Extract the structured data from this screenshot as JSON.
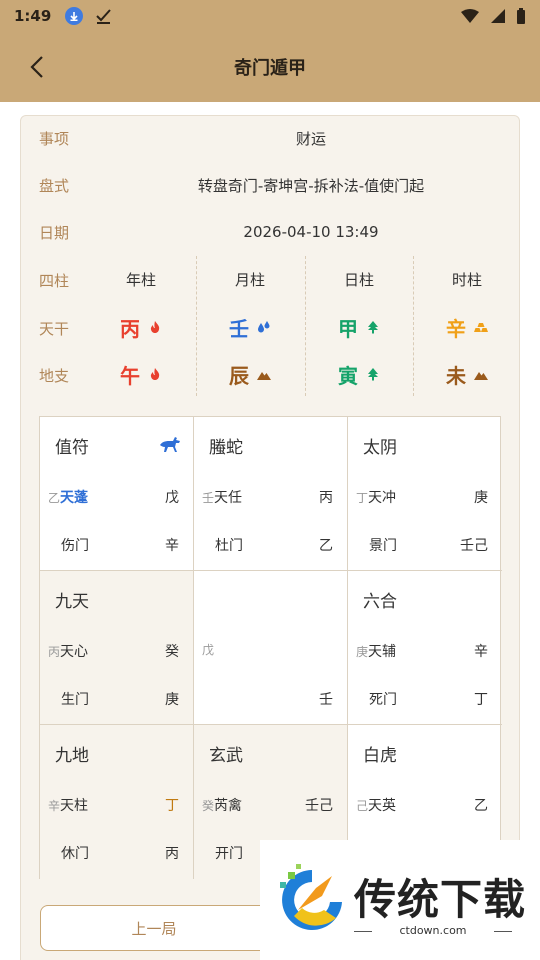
{
  "status": {
    "time": "1:49"
  },
  "header": {
    "title": "奇门遁甲"
  },
  "info": {
    "shixiang_label": "事项",
    "shixiang_value": "财运",
    "panshi_label": "盘式",
    "panshi_value": "转盘奇门-寄坤宫-拆补法-值使门起",
    "riqi_label": "日期",
    "riqi_value": "2026-04-10 13:49"
  },
  "pillars": {
    "label": "四柱",
    "tiangan_label": "天干",
    "dizhi_label": "地支",
    "headers": [
      "年柱",
      "月柱",
      "日柱",
      "时柱"
    ],
    "tiangan": [
      "丙",
      "壬",
      "甲",
      "辛"
    ],
    "dizhi": [
      "午",
      "辰",
      "寅",
      "未"
    ],
    "colors": {
      "fire": "#e8402e",
      "water": "#2f6fd6",
      "wood": "#16a36a",
      "metal": "#f0a018",
      "earth": "#9a5a1c"
    }
  },
  "grid": {
    "cells": [
      {
        "god": "值符",
        "r2_small": "乙",
        "r2_main": "天蓬",
        "r2_right": "戊",
        "r3_left": "伤门",
        "r3_right": "辛"
      },
      {
        "god": "螣蛇",
        "r2_small": "壬",
        "r2_main": "天任",
        "r2_right": "丙",
        "r3_left": "杜门",
        "r3_right": "乙"
      },
      {
        "god": "太阴",
        "r2_small": "丁",
        "r2_main": "天冲",
        "r2_right": "庚",
        "r3_left": "景门",
        "r3_right": "壬己"
      },
      {
        "god": "九天",
        "r2_small": "丙",
        "r2_main": "天心",
        "r2_right": "癸",
        "r3_left": "生门",
        "r3_right": "庚"
      },
      {
        "god": "",
        "r2_small": "戊",
        "r2_main": "",
        "r2_right": "",
        "r3_left": "",
        "r3_right": "壬"
      },
      {
        "god": "六合",
        "r2_small": "庚",
        "r2_main": "天辅",
        "r2_right": "辛",
        "r3_left": "死门",
        "r3_right": "丁"
      },
      {
        "god": "九地",
        "r2_small": "辛",
        "r2_main": "天柱",
        "r2_right": "丁",
        "r3_left": "休门",
        "r3_right": "丙"
      },
      {
        "god": "玄武",
        "r2_small": "癸",
        "r2_main": "芮禽",
        "r2_right": "壬己",
        "r3_left": "开门",
        "r3_right": ""
      },
      {
        "god": "白虎",
        "r2_small": "己",
        "r2_main": "天英",
        "r2_right": "乙",
        "r3_left": "",
        "r3_right": ""
      }
    ]
  },
  "buttons": {
    "prev_label": "上一局"
  },
  "watermark": {
    "text": "传统下载",
    "url": "ctdown.com"
  }
}
